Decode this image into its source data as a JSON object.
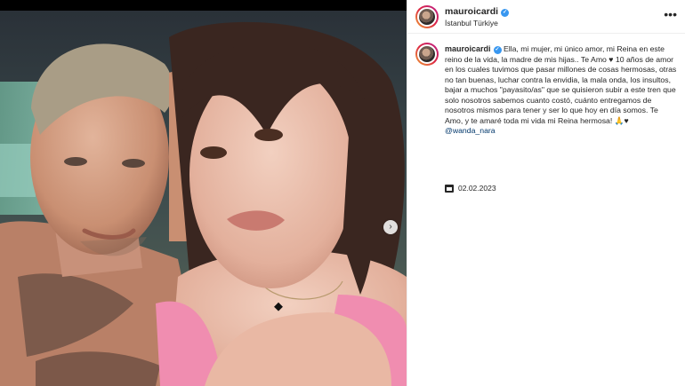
{
  "post": {
    "username": "mauroicardi",
    "verified_mark": "✓",
    "location": "İstanbul Türkiye",
    "more_icon": "•••",
    "carousel_next": "›",
    "caption": {
      "username": "mauroicardi",
      "text": " Ella, mi mujer, mi único amor, mi Reina en este reino de la vida, la madre de mis hijas.. Te Amo ♥ 10 años de amor en los cuales tuvimos que pasar millones de cosas hermosas, otras no tan buenas, luchar contra la envidia, la mala onda, los insultos, bajar a muchos \"payasito/as\" que se quisieron subir a este tren que solo nosotros sabemos cuanto costó, cuánto entregamos de nosotros mismos para tener y ser lo que hoy en día somos. Te Amo, y te amaré toda mi vida mi Reina hermosa! 🙏♥ ",
      "mention": "@wanda_nara"
    },
    "date": "02.02.2023",
    "colors": {
      "verified": "#3897f0",
      "mention": "#00376b",
      "text": "#262626"
    },
    "icons": [
      "more-icon",
      "verified-icon",
      "calendar-icon",
      "carousel-next-icon"
    ]
  }
}
